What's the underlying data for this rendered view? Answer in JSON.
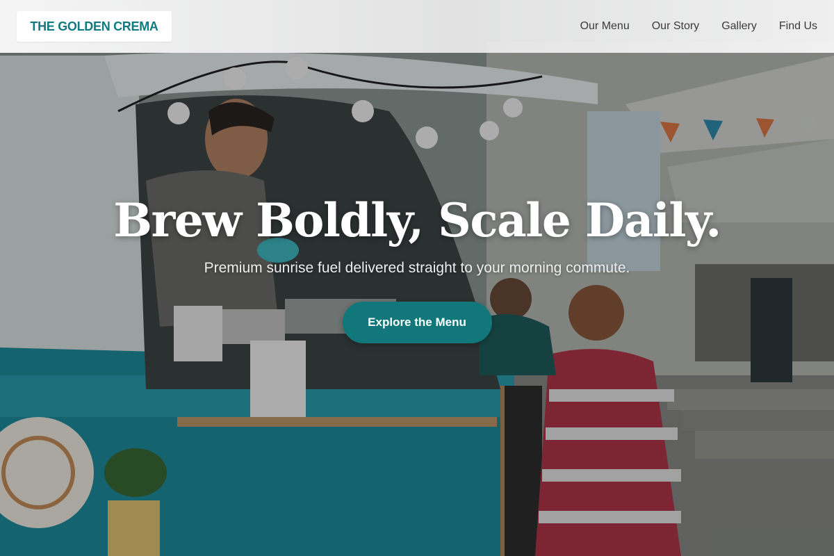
{
  "brand": {
    "name": "THE GOLDEN CREMA",
    "color": "#0f7b80"
  },
  "nav": {
    "links": [
      {
        "label": "Our Menu"
      },
      {
        "label": "Our Story"
      },
      {
        "label": "Gallery"
      },
      {
        "label": "Find Us"
      }
    ]
  },
  "hero": {
    "title": "Brew Boldly, Scale Daily.",
    "subtitle": "Premium sunrise fuel delivered straight to your morning commute.",
    "cta_label": "Explore the Menu",
    "cta_color": "#11777b",
    "background_image": "food-truck-vendor-photo"
  }
}
